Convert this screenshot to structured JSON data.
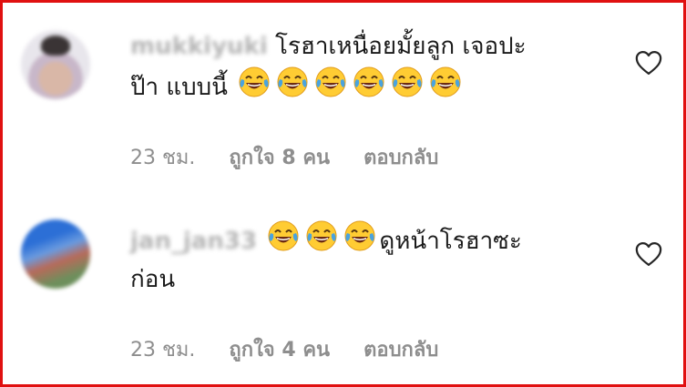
{
  "comments": [
    {
      "username": "mukkiyuki",
      "text_line1": "โรฮาเหนื่อยมั้ยลูก เจอปะ",
      "text_line2": "ป๊า แบบนี้",
      "emoji_count": 6,
      "time": "23 ชม.",
      "likes": "ถูกใจ 8 คน",
      "reply": "ตอบกลับ"
    },
    {
      "username": "jan_jan33",
      "text_line1": "ดูหน้าโรฮาซะ",
      "text_line2": "ก่อน",
      "emoji_count": 3,
      "time": "23 ชม.",
      "likes": "ถูกใจ 4 คน",
      "reply": "ตอบกลับ"
    }
  ],
  "colors": {
    "border": "#e01010",
    "meta": "#8e8e8e",
    "emoji_face": "#ffcc33",
    "tears": "#4aa3df"
  },
  "icons": {
    "emoji": "face-with-tears-of-joy-icon",
    "like": "heart-outline-icon"
  }
}
